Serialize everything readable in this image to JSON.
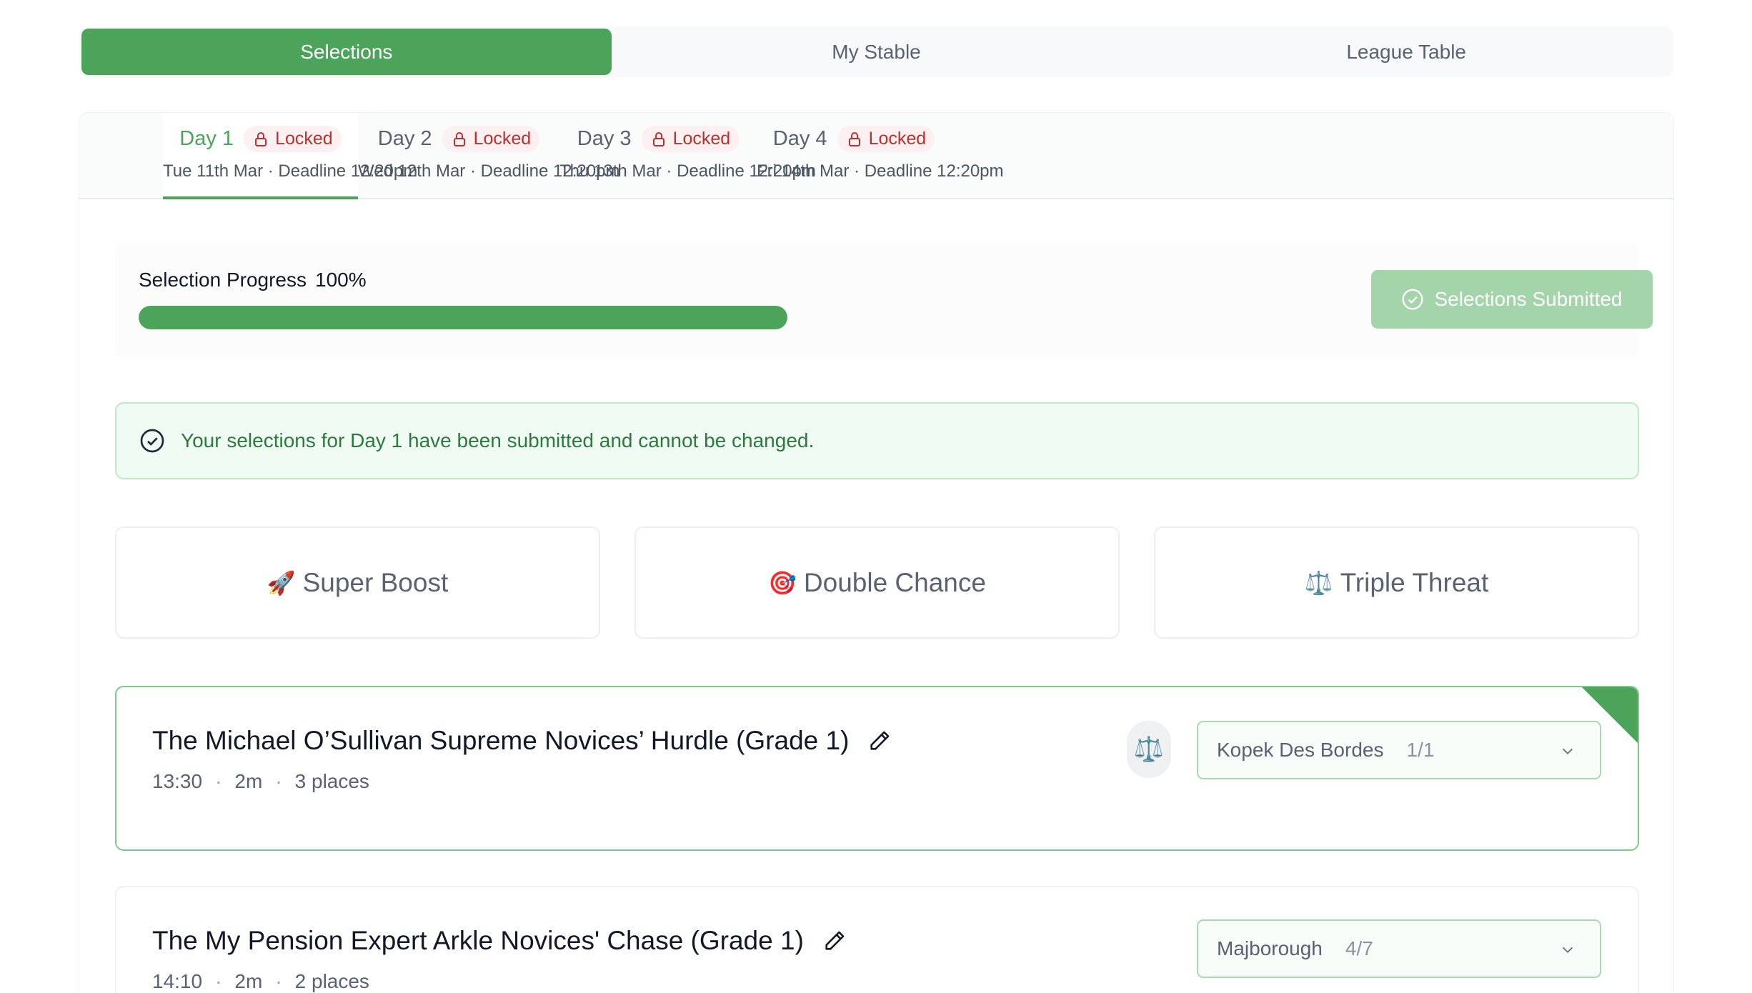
{
  "top_tabs": [
    {
      "label": "Selections",
      "active": true
    },
    {
      "label": "My Stable",
      "active": false
    },
    {
      "label": "League Table",
      "active": false
    }
  ],
  "days": [
    {
      "name": "Day 1",
      "status": "Locked",
      "date": "Tue 11th Mar",
      "deadline": "Deadline 12:20pm",
      "active": true
    },
    {
      "name": "Day 2",
      "status": "Locked",
      "date": "Wed 12th Mar",
      "deadline": "Deadline 12:20pm",
      "active": false
    },
    {
      "name": "Day 3",
      "status": "Locked",
      "date": "Thu 13th Mar",
      "deadline": "Deadline 12:20pm",
      "active": false
    },
    {
      "name": "Day 4",
      "status": "Locked",
      "date": "Fri 14th Mar",
      "deadline": "Deadline 12:20pm",
      "active": false
    }
  ],
  "separator": "·",
  "progress": {
    "label": "Selection Progress",
    "percent_text": "100%",
    "fraction": 1.0
  },
  "submitted_button_label": "Selections Submitted",
  "alert_text": "Your selections for Day 1 have been submitted and cannot be changed.",
  "boosts": [
    {
      "icon": "rocket-icon",
      "emoji": "🚀",
      "label": "Super Boost"
    },
    {
      "icon": "target-icon",
      "emoji": "🎯",
      "label": "Double Chance"
    },
    {
      "icon": "scales-icon",
      "emoji": "⚖️",
      "label": "Triple Threat"
    }
  ],
  "races": [
    {
      "title": "The Michael O’Sullivan Supreme Novices’ Hurdle (Grade 1)",
      "time": "13:30",
      "distance": "2m",
      "places": "3 places",
      "horse": "Kopek Des Bordes",
      "odds": "1/1",
      "badge_icon": "scales-icon",
      "badge_emoji": "⚖️",
      "selected": true
    },
    {
      "title": "The My Pension Expert Arkle Novices' Chase (Grade 1)",
      "time": "14:10",
      "distance": "2m",
      "places": "2 places",
      "horse": "Majborough",
      "odds": "4/7",
      "selected": false
    }
  ],
  "colors": {
    "accent_green": "#4ba45a",
    "locked_red": "#c02f2f",
    "alert_text_green": "#2d7a3f"
  }
}
